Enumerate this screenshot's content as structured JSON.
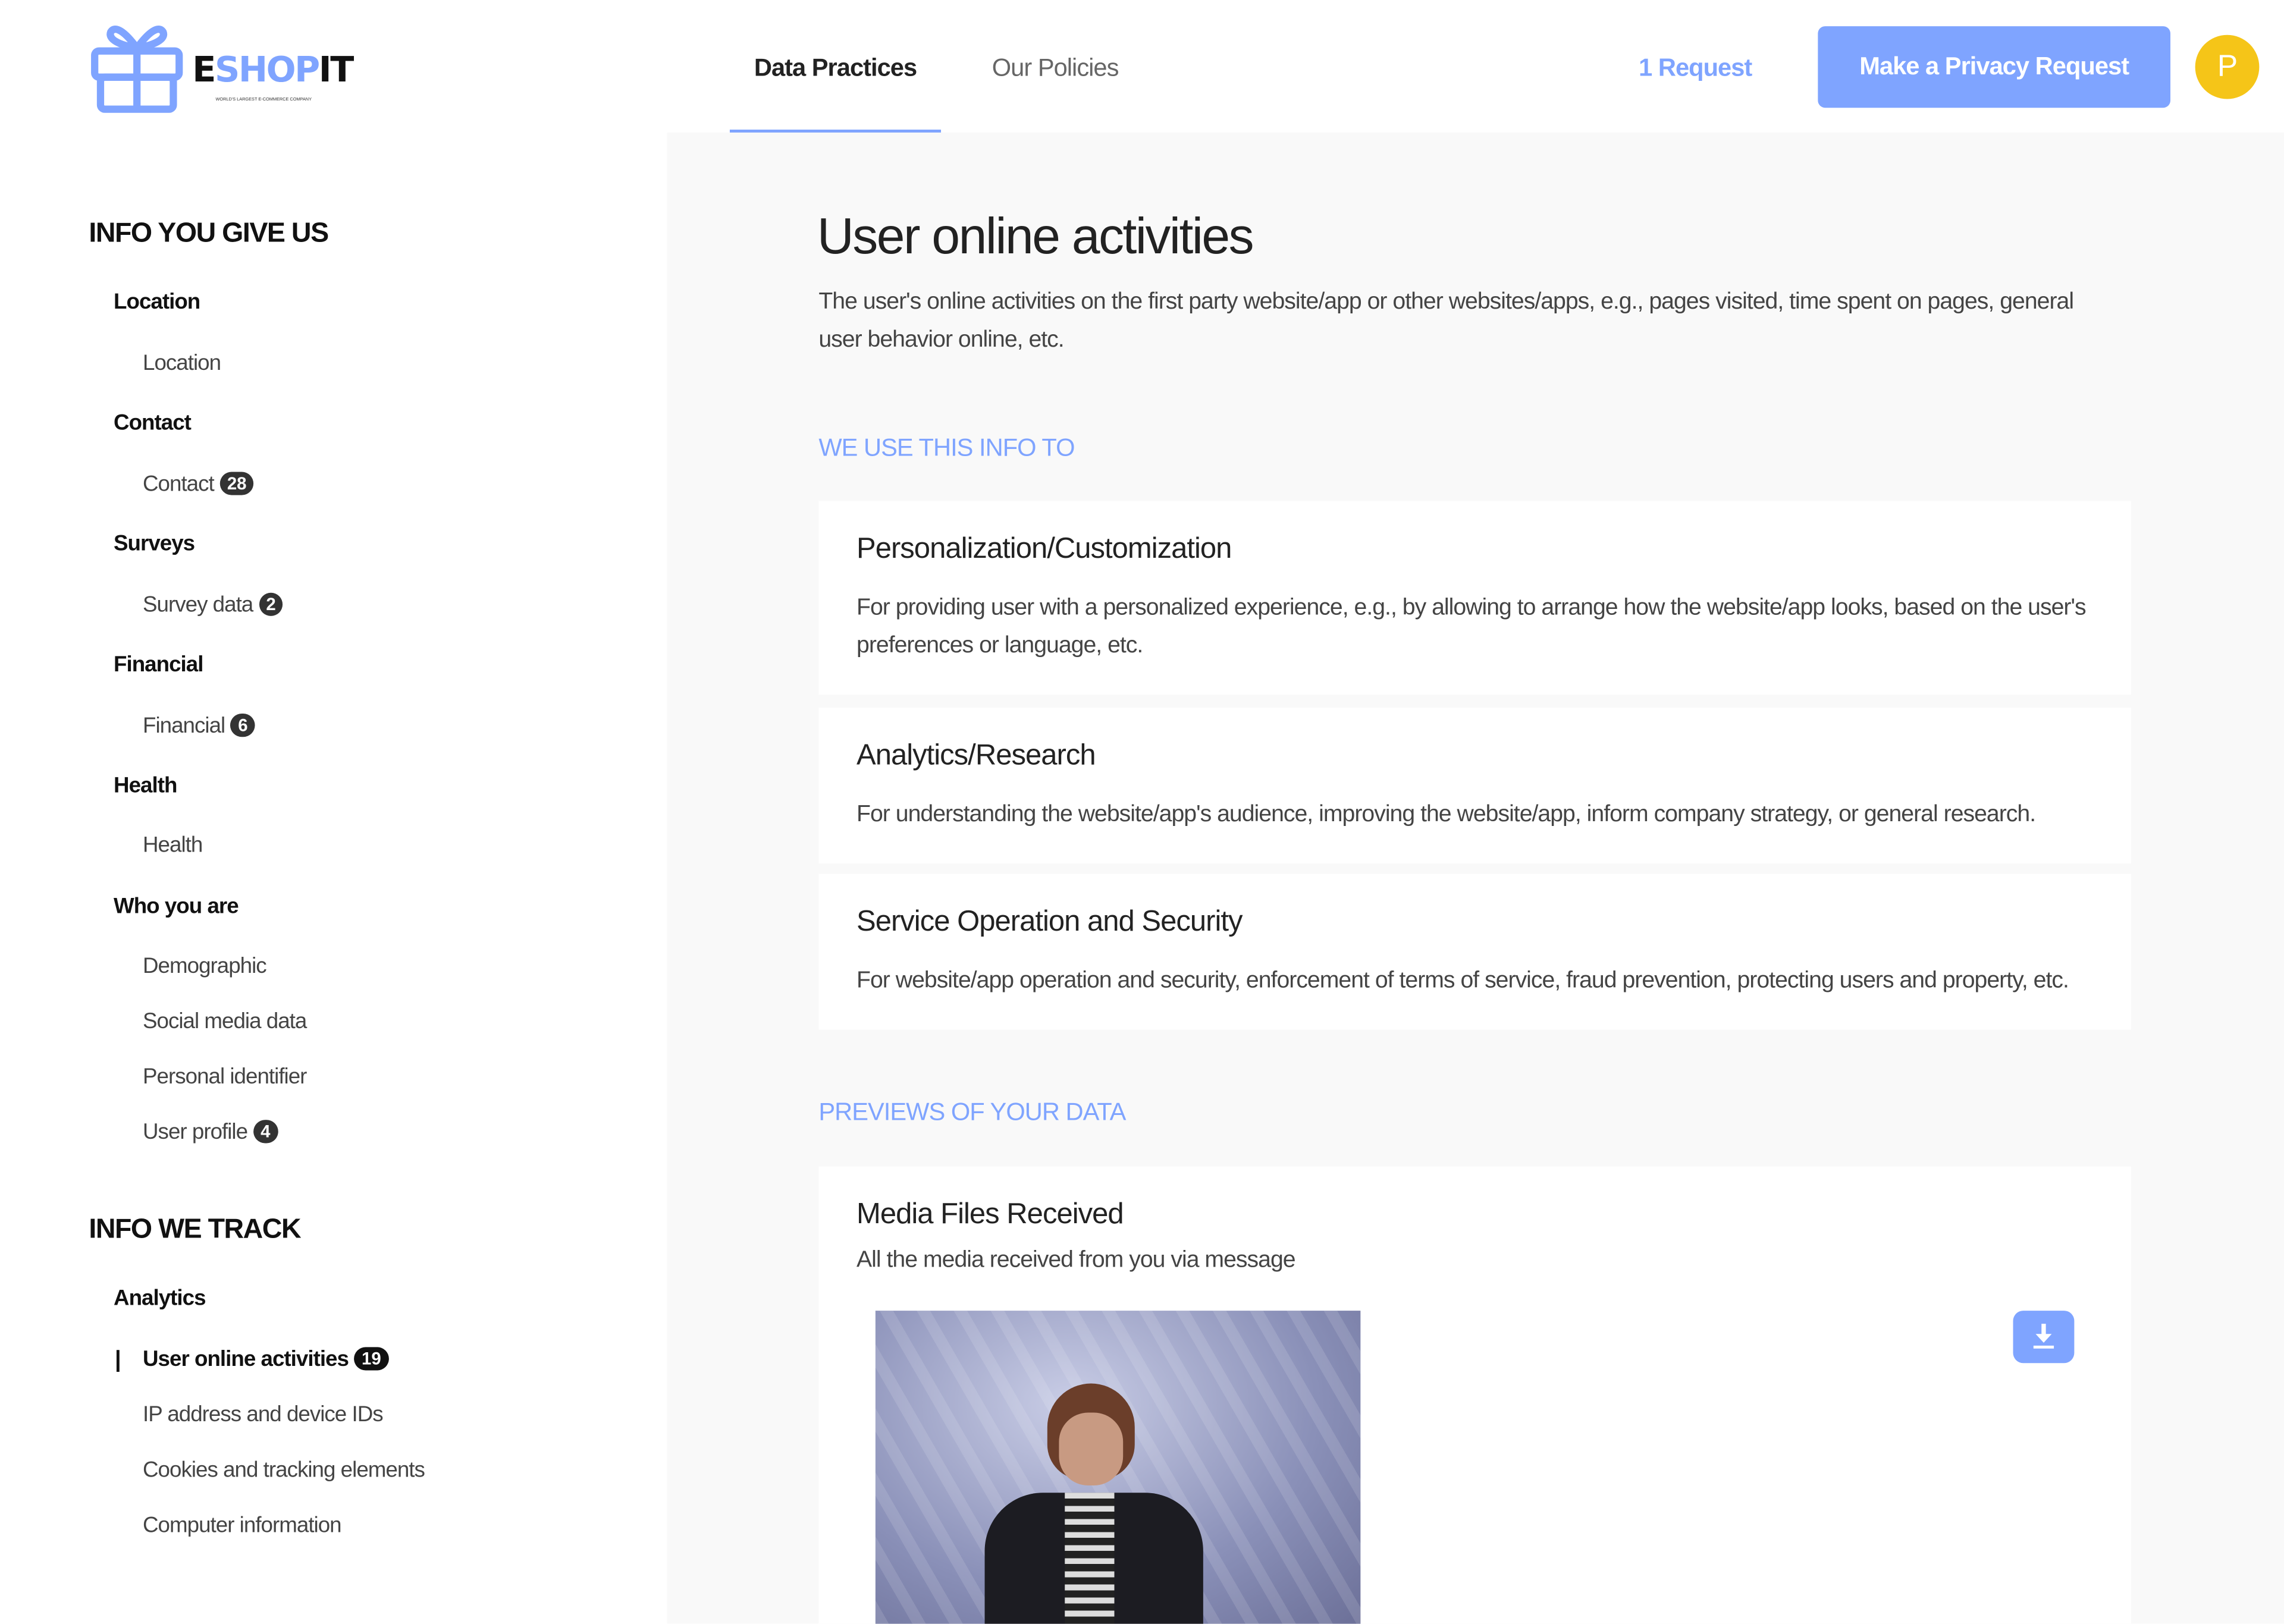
{
  "header": {
    "logo": {
      "text_dark_1": "E",
      "text_blue": "SHOP",
      "text_dark_2": "IT",
      "tagline": "WORLD'S LARGEST E-COMMERCE COMPANY"
    },
    "tabs": [
      {
        "label": "Data Practices",
        "active": true
      },
      {
        "label": "Our Policies",
        "active": false
      }
    ],
    "requests_link": "1 Request",
    "privacy_button": "Make a Privacy Request",
    "avatar_initial": "P"
  },
  "colors": {
    "accent": "#7fa4ff",
    "avatar": "#f5c518"
  },
  "sidebar": {
    "groups": [
      {
        "title": "INFO YOU GIVE US",
        "categories": [
          {
            "label": "Location",
            "items": [
              {
                "label": "Location"
              }
            ]
          },
          {
            "label": "Contact",
            "items": [
              {
                "label": "Contact",
                "count": "28"
              }
            ]
          },
          {
            "label": "Surveys",
            "items": [
              {
                "label": "Survey data",
                "count": "2"
              }
            ]
          },
          {
            "label": "Financial",
            "items": [
              {
                "label": "Financial",
                "count": "6"
              }
            ]
          },
          {
            "label": "Health",
            "items": [
              {
                "label": "Health"
              }
            ]
          },
          {
            "label": "Who you are",
            "items": [
              {
                "label": "Demographic"
              },
              {
                "label": "Social media data"
              },
              {
                "label": "Personal identifier"
              },
              {
                "label": "User profile",
                "count": "4"
              }
            ]
          }
        ]
      },
      {
        "title": "INFO WE TRACK",
        "categories": [
          {
            "label": "Analytics",
            "items": [
              {
                "label": "User online activities",
                "count": "19",
                "active": true
              },
              {
                "label": "IP address and device IDs"
              },
              {
                "label": "Cookies and tracking elements"
              },
              {
                "label": "Computer information"
              }
            ]
          }
        ]
      }
    ]
  },
  "main": {
    "title": "User online activities",
    "description": "The user's online activities on the first party website/app or other websites/apps, e.g., pages visited, time spent on pages, general user behavior online, etc.",
    "uses_heading": "WE USE THIS INFO TO",
    "uses": [
      {
        "title": "Personalization/Customization",
        "description": "For providing user with a personalized experience, e.g., by allowing to arrange how the website/app looks, based on the user's preferences or language, etc."
      },
      {
        "title": "Analytics/Research",
        "description": "For understanding the website/app's audience, improving the website/app, inform company strategy, or general research."
      },
      {
        "title": "Service Operation and Security",
        "description": "For website/app operation and security, enforcement of terms of service, fraud prevention, protecting users and property, etc."
      }
    ],
    "previews_heading": "PREVIEWS OF YOUR DATA",
    "preview": {
      "title": "Media Files Received",
      "description": "All the media received from you via message"
    }
  }
}
